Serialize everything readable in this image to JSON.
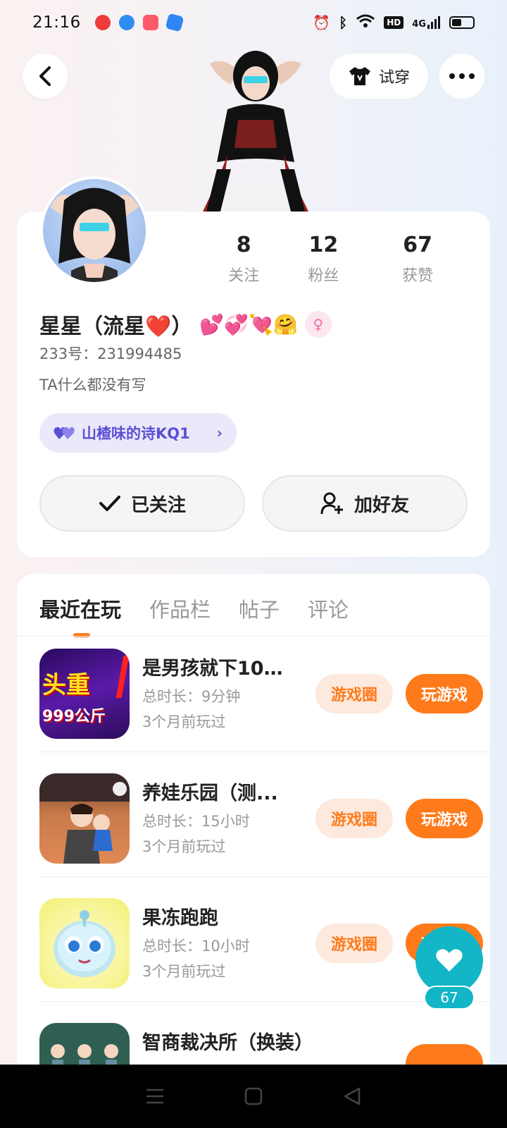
{
  "status_bar": {
    "time": "21:16",
    "network": "4G",
    "hd": "HD"
  },
  "header": {
    "tryon_label": "试穿"
  },
  "profile": {
    "name": "星星（流星❤️）",
    "emojis": "💕💞💘🤗",
    "gender_symbol": "♀",
    "uid": "233号：231994485",
    "bio": "TA什么都没有写",
    "tag_label": "山楂味的诗KQ1",
    "stats": [
      {
        "value": "8",
        "label": "关注"
      },
      {
        "value": "12",
        "label": "粉丝"
      },
      {
        "value": "67",
        "label": "获赞"
      }
    ],
    "follow_button": "已关注",
    "add_friend_button": "加好友"
  },
  "tabs": [
    {
      "label": "最近在玩",
      "active": true
    },
    {
      "label": "作品栏",
      "active": false
    },
    {
      "label": "帖子",
      "active": false
    },
    {
      "label": "评论",
      "active": false
    }
  ],
  "games": [
    {
      "title": "是男孩就下10...",
      "duration": "总时长：9分钟",
      "last_played": "3个月前玩过",
      "circle_label": "游戏圈",
      "play_label": "玩游戏",
      "icon_text_top": "头重",
      "icon_text_bottom": "999公斤"
    },
    {
      "title": "养娃乐园（测...",
      "duration": "总时长：15小时",
      "last_played": "3个月前玩过",
      "circle_label": "游戏圈",
      "play_label": "玩游戏"
    },
    {
      "title": "果冻跑跑",
      "duration": "总时长：10小时",
      "last_played": "3个月前玩过",
      "circle_label": "游戏圈",
      "play_label": "玩游戏"
    },
    {
      "title": "智商裁决所（换装）",
      "duration": "",
      "last_played": "",
      "circle_label": "",
      "play_label": ""
    }
  ],
  "like_fab": {
    "count": "67"
  },
  "colors": {
    "accent_orange": "#ff7a1a",
    "teal": "#12b6c6",
    "tag_purple": "#5b50d6"
  }
}
